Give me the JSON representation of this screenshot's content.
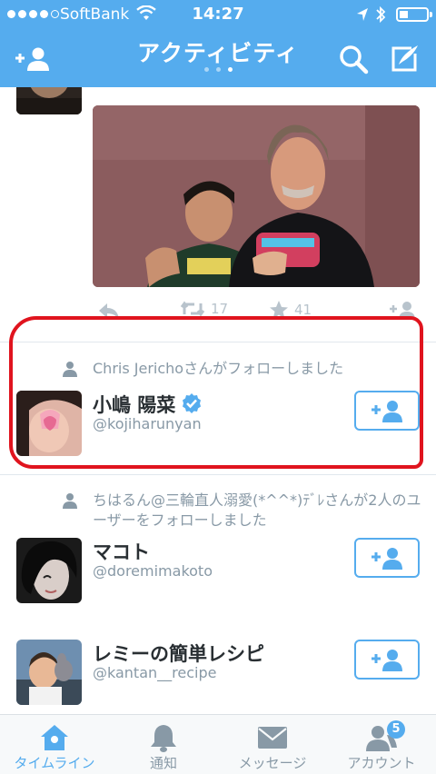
{
  "status_bar": {
    "carrier": "SoftBank",
    "time": "14:27",
    "signal_bars_filled": 4,
    "signal_bars_total": 5
  },
  "header": {
    "title": "アクティビティ",
    "page_dots_total": 3,
    "page_dots_active": 3,
    "add_user_icon": "add-user-icon",
    "search_icon": "search-icon",
    "compose_icon": "compose-icon"
  },
  "tweet": {
    "retweet_count": "17",
    "favorite_count": "41"
  },
  "activities": [
    {
      "context": "Chris Jerichoさんがフォローしました",
      "users": [
        {
          "name": "小嶋 陽菜",
          "handle": "@kojiharunyan",
          "verified": true
        }
      ]
    },
    {
      "context": "ちはるん@三輪直人溺愛(*^^*)ﾃﾞﾚさんが2人のユーザーをフォローしました",
      "users": [
        {
          "name": "マコト",
          "handle": "@doremimakoto",
          "verified": false
        },
        {
          "name": "レミーの簡単レシピ",
          "handle": "@kantan__recipe",
          "verified": false
        }
      ]
    }
  ],
  "tabs": [
    {
      "label": "タイムライン",
      "icon": "home-icon",
      "active": true
    },
    {
      "label": "通知",
      "icon": "bell-icon",
      "active": false
    },
    {
      "label": "メッセージ",
      "icon": "envelope-icon",
      "active": false
    },
    {
      "label": "アカウント",
      "icon": "account-icon",
      "active": false,
      "badge": "5"
    }
  ],
  "colors": {
    "brand": "#55ACEE",
    "highlight_outline": "#E0141E",
    "secondary_text": "#8899A6"
  }
}
